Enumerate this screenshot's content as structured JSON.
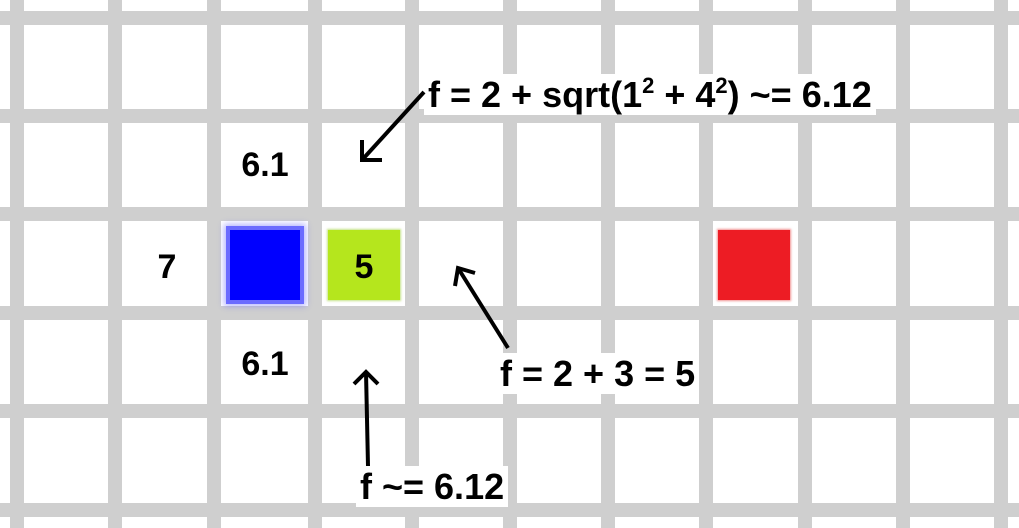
{
  "colors": {
    "background": "#ffffff",
    "grid": "#c8c8c8",
    "start_tile": "#0000ff",
    "current_tile": "#b5e61d",
    "goal_tile": "#ed1c24",
    "text": "#000000"
  },
  "cells": {
    "top_value": "6.1",
    "left_value": "7",
    "current_value": "5",
    "bottom_value": "6.1"
  },
  "annotations": {
    "diagonal": {
      "prefix": "f = 2 + sqrt(1",
      "exp1": "2",
      "middle": " + 4",
      "exp2": "2",
      "suffix": ") ~= 6.12"
    },
    "straight": "f = 2 + 3 = 5",
    "lower": "f ~= 6.12"
  }
}
